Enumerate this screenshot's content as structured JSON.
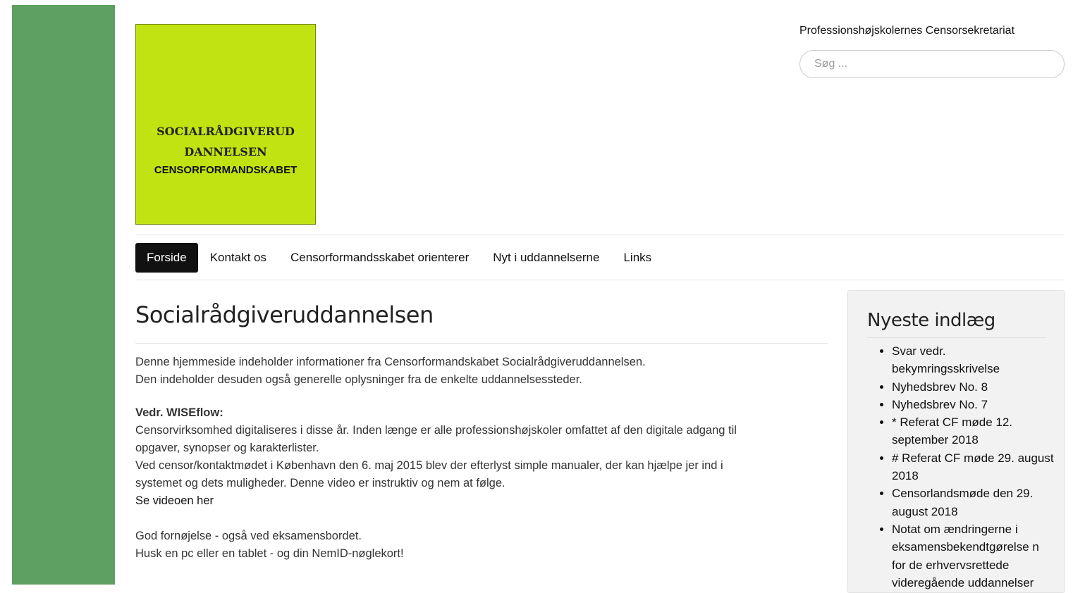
{
  "header": {
    "logo": {
      "line1": "SOCIALRÅDGIVERUD",
      "line2": "DANNELSEN",
      "line3": "CENSORFORMANDSKABET"
    },
    "site_name": "Professionshøjskolernes Censorsekretariat",
    "search": {
      "placeholder": "Søg ..."
    }
  },
  "nav": {
    "items": [
      {
        "label": "Forside",
        "active": true
      },
      {
        "label": "Kontakt os"
      },
      {
        "label": "Censorformandsskabet orienterer"
      },
      {
        "label": "Nyt i uddannelserne"
      },
      {
        "label": "Links"
      }
    ]
  },
  "main": {
    "title": "Socialrådgiveruddannelsen",
    "intro": [
      "Denne hjemmeside indeholder informationer fra Censorformandskabet Socialrådgiveruddannelsen.",
      "Den indeholder desuden også generelle oplysninger fra de enkelte uddannelsessteder."
    ],
    "wiseflow_title": "Vedr. WISEflow:",
    "wiseflow_lines": [
      "Censorvirksomhed digitaliseres i disse år. Inden længe er alle professionshøjskoler omfattet af den digitale adgang til",
      "opgaver, synopser og karakterlister.",
      "Ved censor/kontaktmødet i København den 6. maj 2015 blev der efterlyst simple manualer, der kan hjælpe jer ind i",
      "systemet og dets muligheder. Denne video er instruktiv og nem at følge."
    ],
    "video_link": "Se videoen her",
    "outro": [
      "God fornøjelse - også ved eksamensbordet.",
      "Husk en pc eller en tablet - og din NemID-nøglekort!"
    ]
  },
  "sidebar": {
    "title": "Nyeste indlæg",
    "posts": [
      "Svar vedr. bekymringsskrivelse",
      "Nyhedsbrev No. 8",
      "Nyhedsbrev No. 7",
      "* Referat CF møde 12. september 2018",
      "# Referat CF møde 29. august 2018",
      "Censorlandsmøde den 29. august 2018",
      "Notat om ændringerne i eksamensbekendtgørelse n for de erhvervsrettede videregående uddannelser"
    ]
  },
  "colors": {
    "side_bar": "#5ea062",
    "logo_background": "#c2e312",
    "nav_active_bg": "#111111"
  }
}
